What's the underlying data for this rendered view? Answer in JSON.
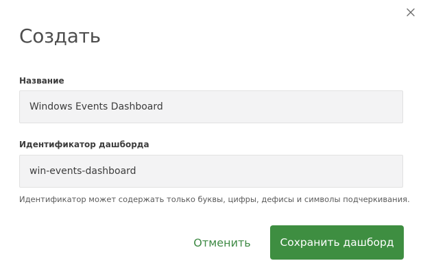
{
  "dialog": {
    "title": "Создать",
    "close_icon": "close-icon"
  },
  "form": {
    "name_field": {
      "label": "Название",
      "value": "Windows Events Dashboard"
    },
    "id_field": {
      "label": "Идентификатор дашборда",
      "value": "win-events-dashboard",
      "hint": "Идентификатор может содержать только буквы, цифры, дефисы и символы подчеркивания."
    }
  },
  "actions": {
    "cancel_label": "Отменить",
    "save_label": "Сохранить дашборд"
  },
  "colors": {
    "accent": "#3e8e41",
    "accent_text": "#3f8a45",
    "input_background": "#f3f3f4"
  }
}
